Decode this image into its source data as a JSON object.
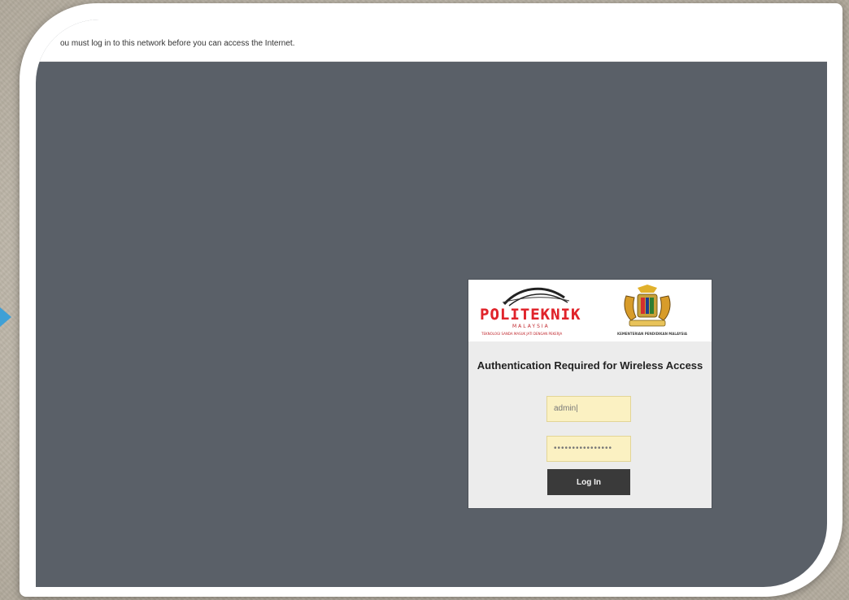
{
  "banner": {
    "notice": "ou must log in to this network before you can access the Internet."
  },
  "login": {
    "title": "Authentication Required for Wireless Access",
    "username_value": "admin|",
    "password_value": "••••••••••••••••",
    "login_label": "Log In"
  },
  "branding": {
    "politeknik_logo_text": "POLITEKNIK",
    "politeknik_logo_subtext": "MALAYSIA",
    "politeknik_logo_tagline": "TEKNOLOGI SANDA MASUK JATI DENGAN PEKERJA",
    "ministry_caption": "KEMENTERIAN PENDIDIKAN MALAYSIA"
  },
  "colors": {
    "accent_red": "#e0242b",
    "page_overlay": "#5a6068",
    "field_fill": "#fbf1c2",
    "button_fill": "#3a3a3a",
    "slide_arrow": "#3fa0d6"
  }
}
